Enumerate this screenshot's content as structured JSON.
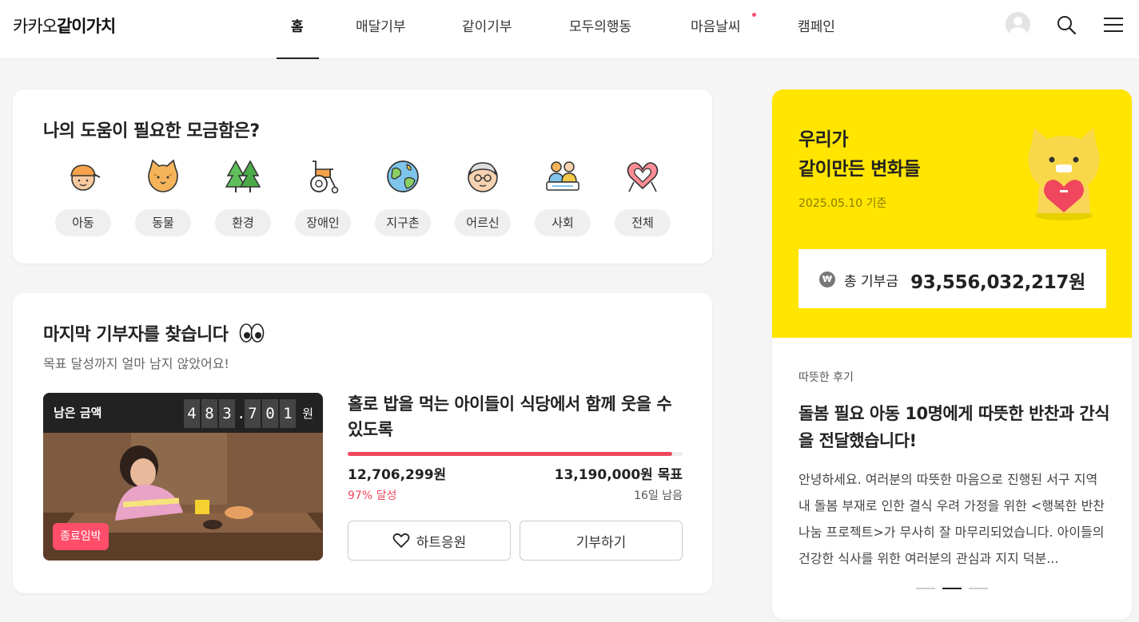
{
  "header": {
    "logo_light": "카카오",
    "logo_bold": "같이가치",
    "nav": [
      {
        "label": "홈",
        "active": true
      },
      {
        "label": "매달기부",
        "active": false
      },
      {
        "label": "같이기부",
        "active": false
      },
      {
        "label": "모두의행동",
        "active": false
      },
      {
        "label": "마음날씨",
        "active": false,
        "new_dot": true
      },
      {
        "label": "캠페인",
        "active": false
      }
    ],
    "icons": [
      "avatar",
      "search-icon",
      "menu-icon"
    ]
  },
  "categories": {
    "title": "나의 도움이 필요한 모금함은?",
    "items": [
      {
        "label": "아동",
        "icon": "child-icon"
      },
      {
        "label": "동물",
        "icon": "cat-icon"
      },
      {
        "label": "환경",
        "icon": "trees-icon"
      },
      {
        "label": "장애인",
        "icon": "wheelchair-icon"
      },
      {
        "label": "지구촌",
        "icon": "globe-icon"
      },
      {
        "label": "어르신",
        "icon": "elder-icon"
      },
      {
        "label": "사회",
        "icon": "people-icon"
      },
      {
        "label": "전체",
        "icon": "heart-ribbon-icon"
      }
    ]
  },
  "last_donor": {
    "title": "마지막 기부자를 찾습니다",
    "subtitle": "목표 달성까지 얼마 남지 않았어요!",
    "remaining_label": "남은 금액",
    "remaining_digits": [
      "4",
      "8",
      "3",
      ".",
      "7",
      "0",
      "1"
    ],
    "remaining_unit": "원",
    "badge": "종료임박",
    "project_title": "홀로 밥을 먹는 아이들이 식당에서 함께 웃을 수 있도록",
    "raised": "12,706,299원",
    "goal": "13,190,000원 목표",
    "percent_label": "97% 달성",
    "progress": 0.97,
    "days_left": "16일 남음",
    "heart_button": "하트응원",
    "donate_button": "기부하기",
    "accent": "#f0475e"
  },
  "summary": {
    "title_line1": "우리가",
    "title_line2": "같이만든 변화들",
    "date": "2025.05.10 기준",
    "total_icon": "₩",
    "total_label": "총 기부금",
    "total_value": "93,556,032,217원",
    "bg_color": "#ffe500"
  },
  "review": {
    "tag": "따뜻한 후기",
    "title": "돌봄 필요 아동 10명에게 따뜻한 반찬과 간식을 전달했습니다!",
    "body": "안녕하세요. 여러분의 따뜻한 마음으로 진행된 서구 지역 내 돌봄 부재로 인한 결식 우려 가정을 위한 <행복한 반찬 나눔 프로젝트>가 무사히 잘 마무리되었습니다. 아이들의 건강한 식사를 위한 여러분의 관심과 지지 덕분...",
    "pager_total": 3,
    "pager_active": 2
  }
}
